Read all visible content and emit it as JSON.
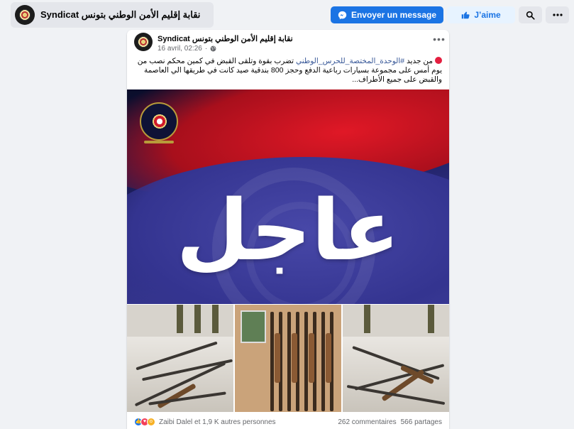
{
  "topbar": {
    "page_name": "Syndicat نقابة إقليم الأمن الوطني بتونس",
    "message_button": "Envoyer un message",
    "like_button": "J’aime",
    "search_icon": "search-icon",
    "more_icon": "more-icon"
  },
  "post": {
    "author": "Syndicat نقابة إقليم الأمن الوطني بتونس",
    "timestamp": "16 avril, 02:26",
    "audience_icon": "globe-icon",
    "options_label": "•••",
    "text": {
      "lead": "من جديد ",
      "hashtag": "#الوحدة_المختصة_للحرس_الوطني",
      "body": " تضرب بقوة وتلقى القبض في كمين محكم نصب من يوم أمس على مجموعة بسيارات رباعية الدفع وحجز 800 بندقية صيد كانت في طريقها الي العاصمة  والقبض على جميع الأطراف..."
    },
    "image": {
      "headline": "عاجل"
    },
    "footer": {
      "reactions": [
        "like",
        "love",
        "wow"
      ],
      "reactors": "Zaibi Dalel et 1,9 K autres personnes",
      "comments": "262 commentaires",
      "shares": "566 partages"
    }
  },
  "colors": {
    "primary": "#1b74e4",
    "background": "#f0f2f5",
    "card": "#ffffff",
    "muted_text": "#65676b"
  }
}
